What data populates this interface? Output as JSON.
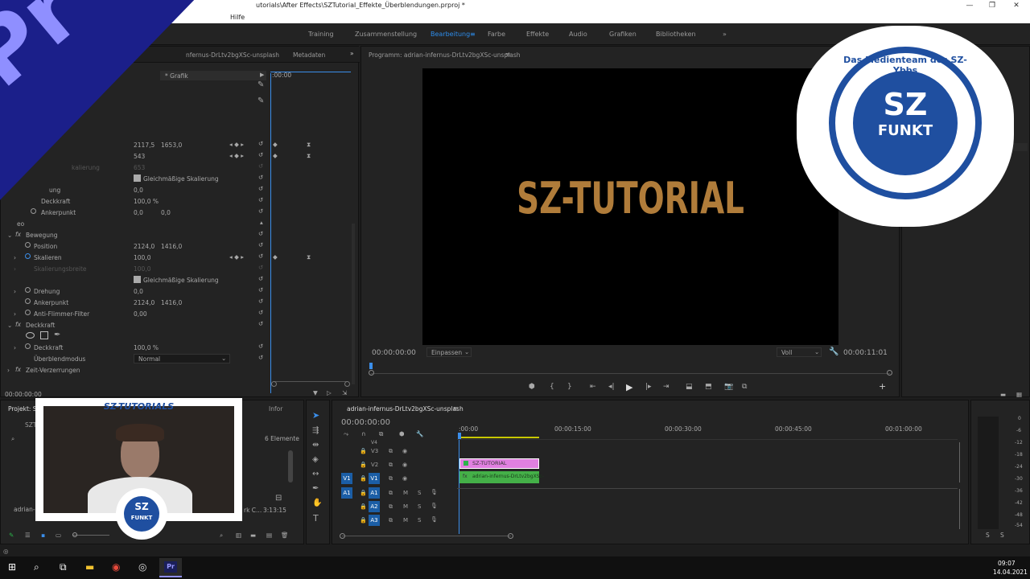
{
  "window": {
    "title": "utorials\\After Effects\\SZTutorial_Effekte_Überblendungen.prproj *",
    "menu_help": "Hilfe"
  },
  "workspaces": [
    {
      "label": "Training"
    },
    {
      "label": "Zusammenstellung"
    },
    {
      "label": "Bearbeitung"
    },
    {
      "label": "Farbe"
    },
    {
      "label": "Effekte"
    },
    {
      "label": "Audio"
    },
    {
      "label": "Grafiken"
    },
    {
      "label": "Bibliotheken"
    }
  ],
  "effect_controls": {
    "source_tab": "nfernus-DrLtv2bgXSc-unsplash",
    "metadata_tab": "Metadaten",
    "source_name": "* Grafik",
    "ruler_time": ":00:00",
    "top_rows": [
      {
        "label": "",
        "v1": "2117,5",
        "v2": "1653,0"
      },
      {
        "label": "",
        "v1": "543",
        "v2": ""
      },
      {
        "label": "kalierung",
        "v1": "653",
        "v2": ""
      },
      {
        "label": "Gleichmäßige Skalierung",
        "v1": "",
        "v2": ""
      },
      {
        "label": "ung",
        "v1": "0,0",
        "v2": ""
      },
      {
        "label": "Deckkraft",
        "v1": "100,0 %",
        "v2": ""
      },
      {
        "label": "Ankerpunkt",
        "v1": "0,0",
        "v2": "0,0"
      }
    ],
    "section_video": "eo",
    "motion": {
      "header": "Bewegung",
      "rows": [
        {
          "label": "Position",
          "v1": "2124,0",
          "v2": "1416,0"
        },
        {
          "label": "Skalieren",
          "v1": "100,0",
          "v2": ""
        },
        {
          "label": "Skalierungsbreite",
          "v1": "100,0",
          "v2": ""
        },
        {
          "label": "Gleichmäßige Skalierung",
          "v1": "",
          "v2": ""
        },
        {
          "label": "Drehung",
          "v1": "0,0",
          "v2": ""
        },
        {
          "label": "Ankerpunkt",
          "v1": "2124,0",
          "v2": "1416,0"
        },
        {
          "label": "Anti-Flimmer-Filter",
          "v1": "0,00",
          "v2": ""
        }
      ]
    },
    "opacity": {
      "header": "Deckkraft",
      "value_label": "Deckkraft",
      "value": "100,0 %",
      "blend_label": "Überblendmodus",
      "blend_value": "Normal"
    },
    "time_remap": "Zeit-Verzerrungen",
    "timecode": "00:00:00:00"
  },
  "program_monitor": {
    "tab": "Programm: adrian-infernus-DrLtv2bgXSc-unsplash",
    "title_text": "SZ-TUTORIAL",
    "timecode": "00:00:00:00",
    "fit": "Einpassen",
    "quality": "Voll",
    "duration": "00:00:11:01"
  },
  "project": {
    "tab": "Projekt: S",
    "info_tab": "Infor",
    "elements": "6 Elemente",
    "folder": "SZT",
    "clip_name": "adrian-i",
    "clip_name2": "rk C...",
    "clip_duration": "3:13:15"
  },
  "webcam": {
    "banner": "SZ-TUTORIALS"
  },
  "timeline": {
    "tab": "adrian-infernus-DrLtv2bgXSc-unsplash",
    "timecode": "00:00:00:00",
    "ruler": [
      ":00:00",
      "00:00:15:00",
      "00:00:30:00",
      "00:00:45:00",
      "00:01:00:00"
    ],
    "video_tracks": [
      "V4",
      "V3",
      "V2",
      "V1"
    ],
    "audio_tracks": [
      "A1",
      "A2",
      "A3"
    ],
    "src_v": "V1",
    "src_a": "A1",
    "clip_title": "SZ-TUTORIAL",
    "clip_video": "adrian-infernus-DrLtv2bgXSc-",
    "mute": "M",
    "solo": "S"
  },
  "meter": {
    "labels": [
      "0",
      "-6",
      "-12",
      "-18",
      "-24",
      "-30",
      "-36",
      "-42",
      "-48",
      "-54"
    ],
    "s1": "S",
    "s2": "S"
  },
  "badge": {
    "ring_text": "Das Medienteam des SZ-Ybbs",
    "top": "SZ",
    "bottom": "FUNKT"
  },
  "app_logo": "Pr",
  "taskbar": {
    "time": "09:07",
    "date": "14.04.2021",
    "app_pr": "Pr"
  }
}
